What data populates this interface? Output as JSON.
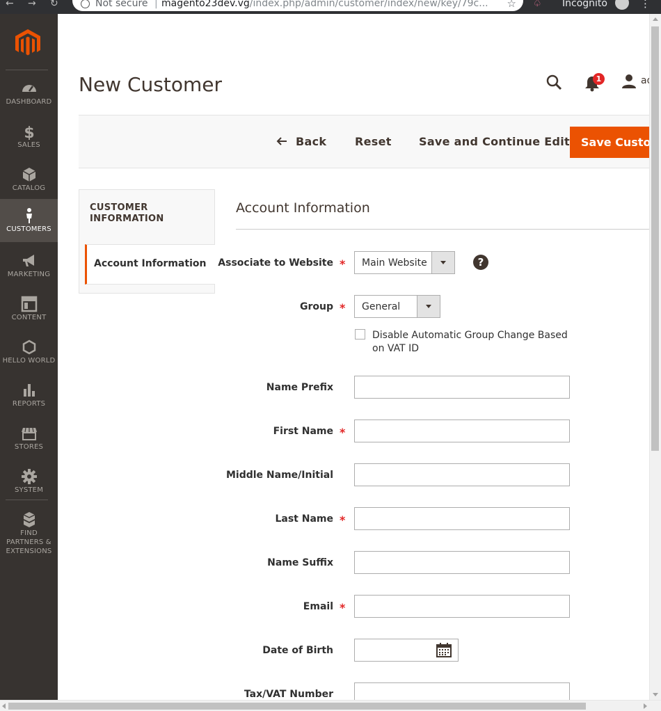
{
  "browser": {
    "not_secure": "Not secure",
    "separator": "|",
    "host": "magento23dev.vg",
    "path": "/index.php/admin/customer/index/new/key/79c...",
    "incognito": "Incognito"
  },
  "sidebar": {
    "items": [
      {
        "label": "DASHBOARD",
        "icon": "dashboard-icon"
      },
      {
        "label": "SALES",
        "icon": "dollar-icon"
      },
      {
        "label": "CATALOG",
        "icon": "box-icon"
      },
      {
        "label": "CUSTOMERS",
        "icon": "person-icon",
        "active": true
      },
      {
        "label": "MARKETING",
        "icon": "megaphone-icon"
      },
      {
        "label": "CONTENT",
        "icon": "layout-icon"
      },
      {
        "label": "HELLO WORLD",
        "icon": "hexagon-icon"
      },
      {
        "label": "REPORTS",
        "icon": "bar-chart-icon"
      },
      {
        "label": "STORES",
        "icon": "storefront-icon"
      },
      {
        "label": "SYSTEM",
        "icon": "gear-icon"
      },
      {
        "label": "FIND PARTNERS & EXTENSIONS",
        "icon": "cubes-icon"
      }
    ]
  },
  "header": {
    "title": "New Customer",
    "notification_count": "1",
    "user_name": "ad"
  },
  "actions": {
    "back": "Back",
    "reset": "Reset",
    "save_continue": "Save and Continue Edit",
    "save": "Save Customer"
  },
  "tabs": {
    "title": "CUSTOMER INFORMATION",
    "active_item": "Account Information"
  },
  "section": {
    "title": "Account Information"
  },
  "form": {
    "website_label": "Associate to Website",
    "website_value": "Main Website",
    "group_label": "Group",
    "group_value": "General",
    "disable_group_change": "Disable Automatic Group Change Based on VAT ID",
    "name_prefix": "Name Prefix",
    "first_name": "First Name",
    "middle_name": "Middle Name/Initial",
    "last_name": "Last Name",
    "name_suffix": "Name Suffix",
    "email": "Email",
    "dob": "Date of Birth",
    "tax_vat": "Tax/VAT Number",
    "required_marker": "*",
    "help": "?"
  },
  "colors": {
    "accent": "#eb5202",
    "sidebar": "#373330",
    "required": "#e22626"
  }
}
